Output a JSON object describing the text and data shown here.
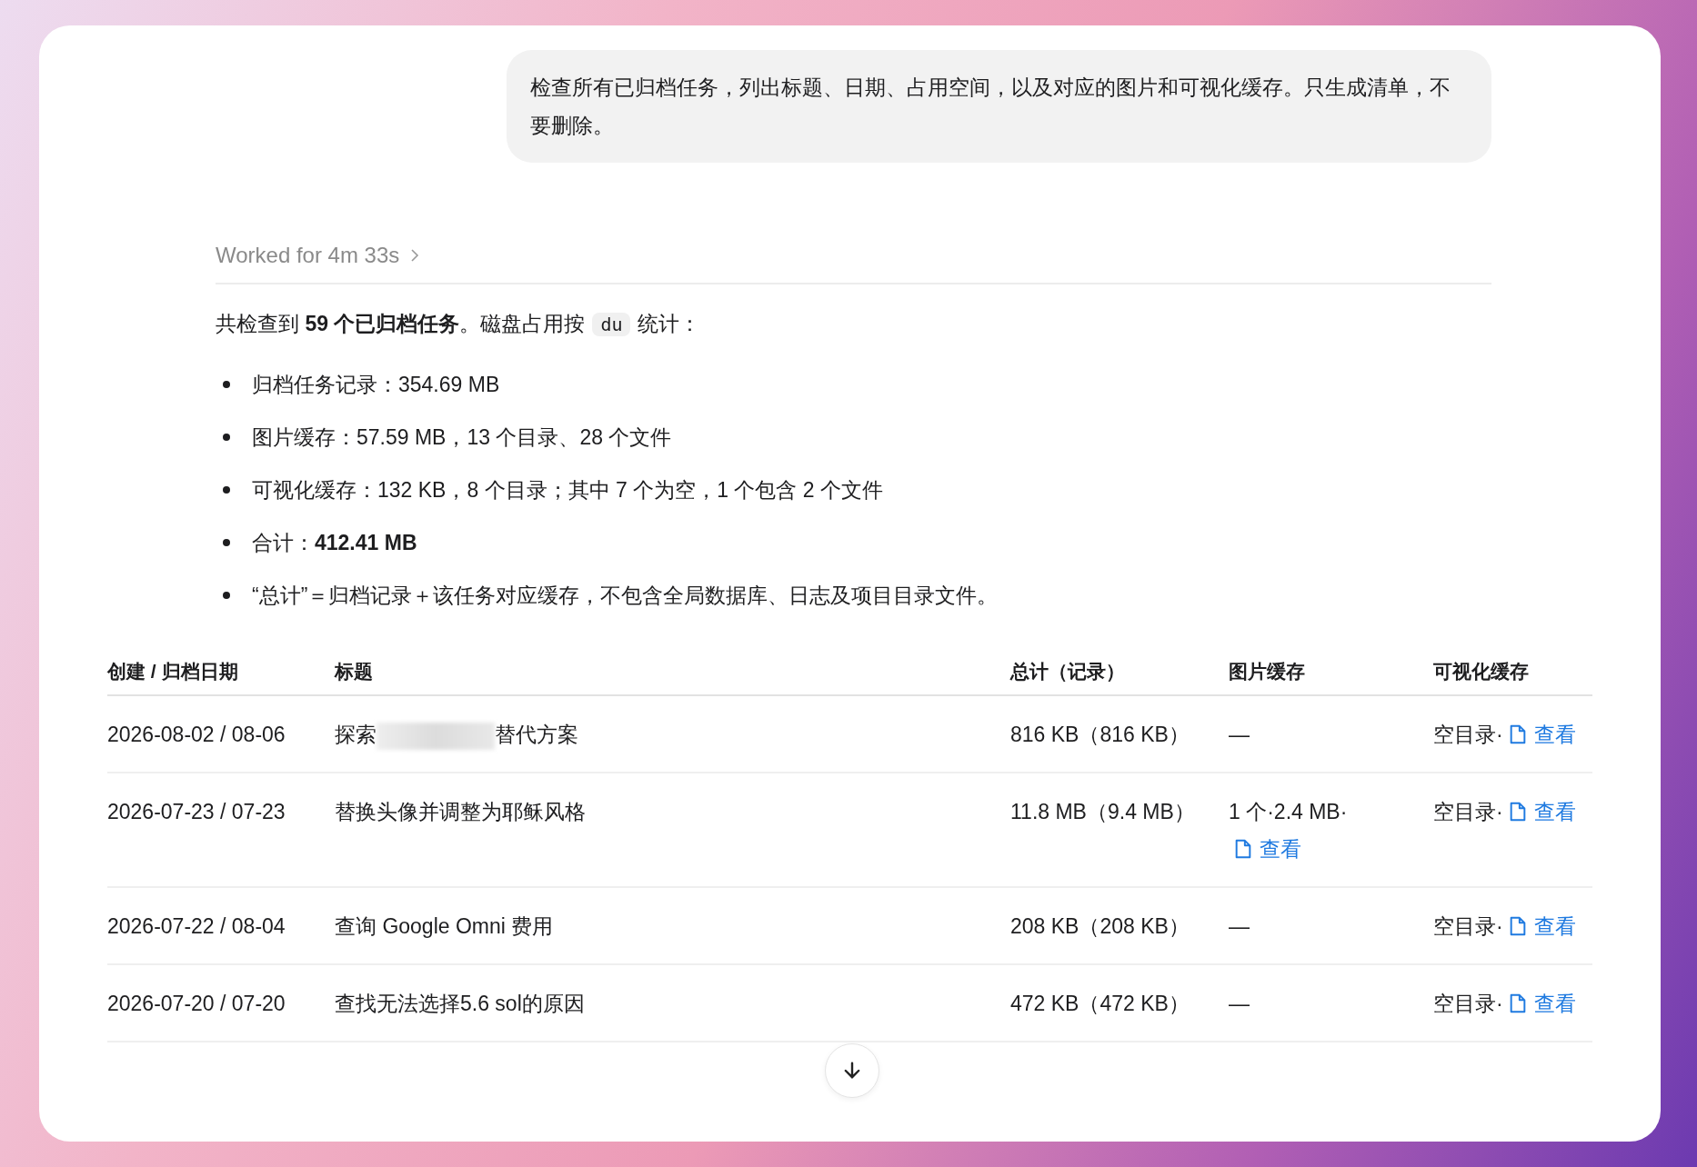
{
  "user_message": "检查所有已归档任务，列出标题、日期、占用空间，以及对应的图片和可视化缓存。只生成清单，不要删除。",
  "worked_for": {
    "label": "Worked for 4m 33s",
    "expanded": false
  },
  "intro": {
    "before": "共检查到 **59 个已归档任务**。磁盘占用按",
    "code": "du",
    "after": "统计："
  },
  "bullets": [
    "归档任务记录：354.69 MB",
    "图片缓存：57.59 MB，13 个目录、28 个文件",
    "可视化缓存：132 KB，8 个目录；其中 7 个为空，1 个包含 2 个文件",
    "合计：**412.41 MB**",
    "“总计”＝归档记录＋该任务对应缓存，不包含全局数据库、日志及项目目录文件。"
  ],
  "table": {
    "columns": [
      "创建 / 归档日期",
      "标题",
      "总计（记录）",
      "图片缓存",
      "可视化缓存"
    ],
    "rows": [
      {
        "date": "2026-08-02 / 08-06",
        "title_parts": [
          "探索",
          "替代方案"
        ],
        "redacted": true,
        "total": "816 KB（816 KB）",
        "image_cache": {
          "text": "—"
        },
        "vis_cache": {
          "text": "空目录·",
          "link": "查看"
        }
      },
      {
        "date": "2026-07-23 / 07-23",
        "title_parts": [
          "替换头像并调整为耶稣风格"
        ],
        "redacted": false,
        "total": "11.8 MB（9.4 MB）",
        "image_cache": {
          "text": "1 个·2.4 MB·",
          "link": "查看"
        },
        "vis_cache": {
          "text": "空目录·",
          "link": "查看"
        }
      },
      {
        "date": "2026-07-22 / 08-04",
        "title_parts": [
          "查询 Google Omni 费用"
        ],
        "redacted": false,
        "total": "208 KB（208 KB）",
        "image_cache": {
          "text": "—"
        },
        "vis_cache": {
          "text": "空目录·",
          "link": "查看"
        }
      },
      {
        "date": "2026-07-20 / 07-20",
        "title_parts": [
          "查找无法选择5.6 sol的原因"
        ],
        "redacted": false,
        "total": "472 KB（472 KB）",
        "image_cache": {
          "text": "—"
        },
        "vis_cache": {
          "text": "空目录·",
          "link": "查看"
        }
      }
    ]
  }
}
